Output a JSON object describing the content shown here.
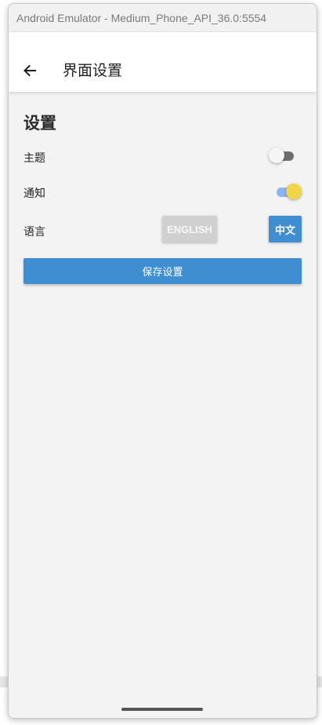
{
  "window": {
    "title": "Android Emulator - Medium_Phone_API_36.0:5554"
  },
  "app_bar": {
    "back_icon": "arrow-left-icon",
    "title": "界面设置"
  },
  "settings": {
    "section_title": "设置",
    "theme": {
      "label": "主题",
      "enabled": false
    },
    "notifications": {
      "label": "通知",
      "enabled": true
    },
    "language": {
      "label": "语言",
      "options": [
        "ENGLISH",
        "中文"
      ],
      "selected": "中文"
    },
    "save_label": "保存设置"
  },
  "colors": {
    "primary": "#3f8ed1",
    "switch_on_thumb": "#f2d544",
    "switch_on_track": "#8ab4f8",
    "background": "#f3f3f3"
  }
}
